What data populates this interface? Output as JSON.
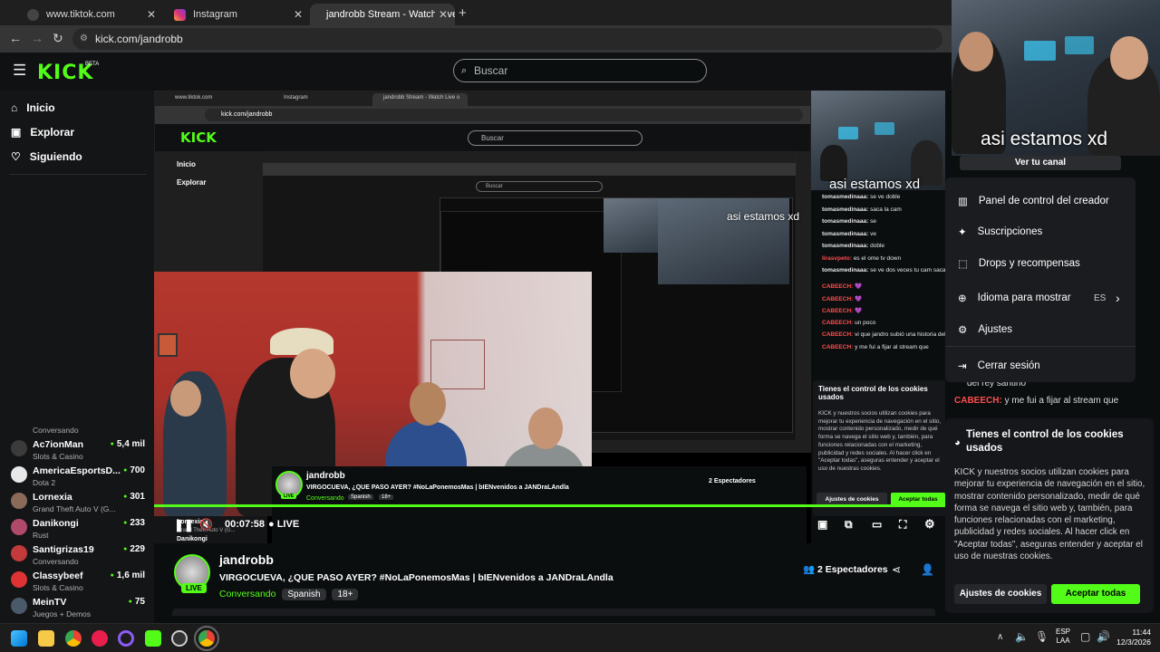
{
  "tabs": [
    {
      "title": "www.tiktok.com",
      "icon": "tiktok-icon"
    },
    {
      "title": "Instagram",
      "icon": "instagram-icon"
    },
    {
      "title": "jandrobb Stream - Watch Live o",
      "icon": "kick-icon"
    }
  ],
  "address": {
    "url": "kick.com/jandrobb"
  },
  "header": {
    "logo": "KICK",
    "beta": "BETA",
    "search_placeholder": "Buscar"
  },
  "sidebar": {
    "links": [
      {
        "label": "Inicio",
        "icon": "home-icon"
      },
      {
        "label": "Explorar",
        "icon": "compass-icon"
      },
      {
        "label": "Siguiendo",
        "icon": "heart-icon"
      }
    ],
    "partial_category": "Conversando",
    "streams": [
      {
        "name": "Ac7ionMan",
        "game": "Slots & Casino",
        "viewers": "5,4 mil",
        "color": "#3b3b3b"
      },
      {
        "name": "AmericaEsportsD...",
        "game": "Dota 2",
        "viewers": "700",
        "color": "#e8e8e8"
      },
      {
        "name": "Lornexia",
        "game": "Grand Theft Auto V (G...",
        "viewers": "301",
        "color": "#8a6b5a"
      },
      {
        "name": "Danikongi",
        "game": "Rust",
        "viewers": "233",
        "color": "#b04a6a"
      },
      {
        "name": "Santigrizas19",
        "game": "Conversando",
        "viewers": "229",
        "color": "#c23a3a"
      },
      {
        "name": "Classybeef",
        "game": "Slots & Casino",
        "viewers": "1,6 mil",
        "color": "#d33"
      },
      {
        "name": "MeinTV",
        "game": "Juegos + Demos",
        "viewers": "75",
        "color": "#4a5a6a"
      }
    ]
  },
  "nested": {
    "tab1": "www.tiktok.com",
    "tab2": "Instagram",
    "tab3": "jandrobb Stream - Watch Live o",
    "url": "kick.com/jandrobb",
    "search": "Buscar",
    "home": "Inicio",
    "explore": "Explorar",
    "conversando": "Conversando",
    "spanish": "Spanish",
    "adult": "18+"
  },
  "stream": {
    "channel": "jandrobb",
    "title": "VIRGOCUEVA, ¿QUE PASO AYER? #NoLaPonemosMas | bIENvenidos a JANDraLAndla",
    "category": "Conversando",
    "tags": [
      "Spanish",
      "18+"
    ],
    "live": "LIVE",
    "viewers": "2 Espectadores",
    "time": "00:07:58",
    "progress": 1.0
  },
  "webcam": {
    "caption_top": "asi estamos xd",
    "caption_mid": "asi estamos xd",
    "caption_small": "asi estamos xd"
  },
  "menu": {
    "view_channel": "Ver tu canal",
    "items": [
      {
        "label": "Panel de control del creador",
        "icon": "dashboard-icon"
      },
      {
        "label": "Suscripciones",
        "icon": "sparkle-icon"
      },
      {
        "label": "Drops y recompensas",
        "icon": "gift-icon"
      },
      {
        "label": "Idioma para mostrar",
        "icon": "globe-icon",
        "value": "ES"
      },
      {
        "label": "Ajustes",
        "icon": "gear-icon"
      },
      {
        "label": "Cerrar sesión",
        "icon": "logout-icon"
      }
    ]
  },
  "chat": {
    "lines": [
      {
        "user": "tomasmedinaaa:",
        "text": "se ve doble"
      },
      {
        "user": "tomasmedinaaa:",
        "text": "saca la cam"
      },
      {
        "user": "tomasmedinaaa:",
        "text": "se"
      },
      {
        "user": "tomasmedinaaa:",
        "text": "ve"
      },
      {
        "user": "tomasmedinaaa:",
        "text": "doble"
      },
      {
        "user": "lirasvpeto:",
        "text": "es el ome tv down"
      },
      {
        "user": "tomasmedinaaa:",
        "text": "se ve dos veces tu cam saca una"
      },
      {
        "user": "CABEECH:",
        "text": "💜"
      },
      {
        "user": "CABEECH:",
        "text": "💜"
      },
      {
        "user": "CABEECH:",
        "text": "💜"
      },
      {
        "user": "CABEECH:",
        "text": "un poco"
      },
      {
        "user": "CABEECH:",
        "text": "vi que jandro subió una historia del rey santino"
      },
      {
        "user": "CABEECH:",
        "text": "y me fui a fijar al stream que"
      }
    ],
    "right_line1": "del rey santino",
    "right_user": "CABEECH:",
    "right_line2": "y me fui a fijar al stream que"
  },
  "cookies": {
    "title": "Tienes el control de los cookies usados",
    "body": "KICK y nuestros socios utilizan cookies para mejorar tu experiencia de navegación en el sitio, mostrar contenido personalizado, medir de qué forma se navega el sitio web y, también, para funciones relacionadas con el marketing, publicidad y redes sociales. Al hacer click en \"Aceptar todas\", aseguras entender y aceptar el uso de nuestras cookies.",
    "settings": "Ajustes de cookies",
    "accept": "Aceptar todas"
  },
  "taskbar": {
    "lang1": "ESP",
    "lang2": "LAA",
    "time": "11:44",
    "date": "12/3/2026"
  },
  "colors": {
    "accent": "#53fc18",
    "bg": "#0b0e0f",
    "chat_red": "#ff4d4d"
  }
}
